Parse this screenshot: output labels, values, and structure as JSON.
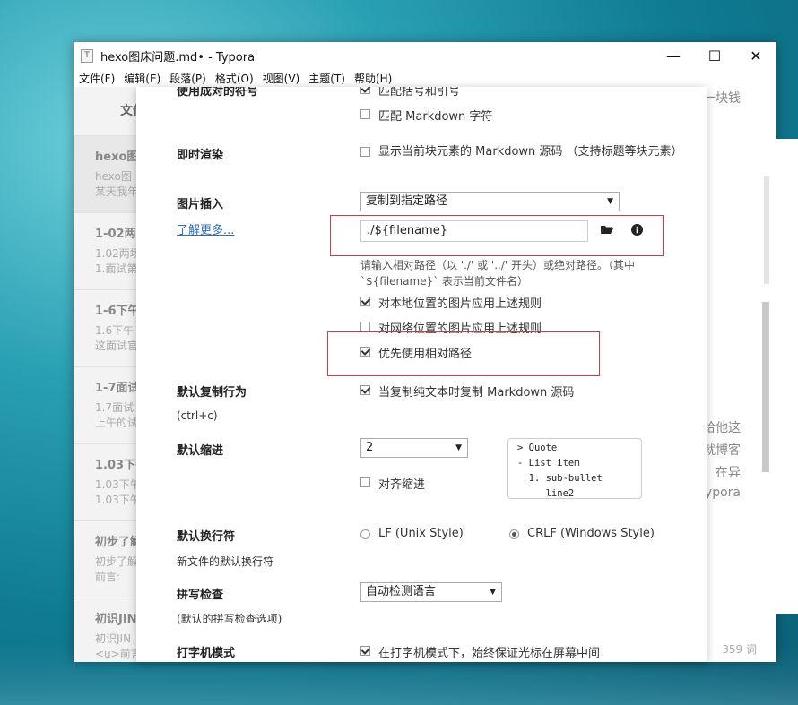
{
  "window": {
    "title": "hexo图床问题.md• - Typora",
    "title_icon": "T",
    "controls": {
      "minimize": "—",
      "maximize": "☐",
      "close": "✕"
    }
  },
  "menubar": [
    "文件(F)",
    "编辑(E)",
    "段落(P)",
    "格式(O)",
    "视图(V)",
    "主题(T)",
    "帮助(H)"
  ],
  "sidebar": {
    "tab": "文件",
    "items": [
      {
        "title": "hexo图",
        "sub1": "hexo图",
        "sub2": "某天我年"
      },
      {
        "title": "1-02两",
        "sub1": "1.02两场",
        "sub2": "1.面试第"
      },
      {
        "title": "1-6下午",
        "sub1": "1.6下午",
        "sub2": "这面试官"
      },
      {
        "title": "1-7面试",
        "sub1": "1.7面试",
        "sub2": "上午的试"
      },
      {
        "title": "1.03下午",
        "sub1": "1.03下午",
        "sub2": "1.03下午"
      },
      {
        "title": "初步了解",
        "sub1": "初步了解",
        "sub2": "前言:"
      },
      {
        "title": "初识JIN",
        "sub1": "初识JIN",
        "sub2": "<u>前言"
      }
    ]
  },
  "editor": {
    "top_text": "一块钱",
    "side_lines": [
      "给他这",
      "就博客",
      "在异",
      "ypora"
    ],
    "word_count": "359 词"
  },
  "dialog": {
    "partial_top_label": "使用成对的符号",
    "partial_top_option": "匹配括号和引号",
    "option_match_markdown": "匹配 Markdown 字符",
    "instant_render": {
      "label": "即时渲染",
      "option": "显示当前块元素的 Markdown 源码 （支持标题等块元素）"
    },
    "image_insert": {
      "label": "图片插入",
      "learn_more": "了解更多...",
      "select_value": "复制到指定路径",
      "path_value": "./${filename}",
      "folder_icon": "folder-open-icon",
      "info_icon": "info-icon",
      "hint": "请输入相对路径（以 './' 或 '../' 开头）或绝对路径。（其中 `${filename}` 表示当前文件名）",
      "option_local": "对本地位置的图片应用上述规则",
      "option_network": "对网络位置的图片应用上述规则",
      "option_relative": "优先使用相对路径"
    },
    "copy_behavior": {
      "label": "默认复制行为",
      "sublabel": "(ctrl+c)",
      "option": "当复制纯文本时复制 Markdown 源码"
    },
    "indent": {
      "label": "默认缩进",
      "select_value": "2",
      "option_align": "对齐缩进",
      "preview": "> Quote\n- List item\n  1. sub-bullet\n     line2"
    },
    "line_ending": {
      "label": "默认换行符",
      "sublabel": "新文件的默认换行符",
      "option_lf": "LF (Unix Style)",
      "option_crlf": "CRLF (Windows Style)"
    },
    "spellcheck": {
      "label": "拼写检查",
      "sublabel": "(默认的拼写检查选项)",
      "select_value": "自动检测语言"
    },
    "typewriter": {
      "label": "打字机模式",
      "option": "在打字机模式下，始终保证光标在屏幕中间"
    }
  },
  "colors": {
    "accent_link": "#2a6ebb",
    "highlight_box": "#d23c3c"
  }
}
